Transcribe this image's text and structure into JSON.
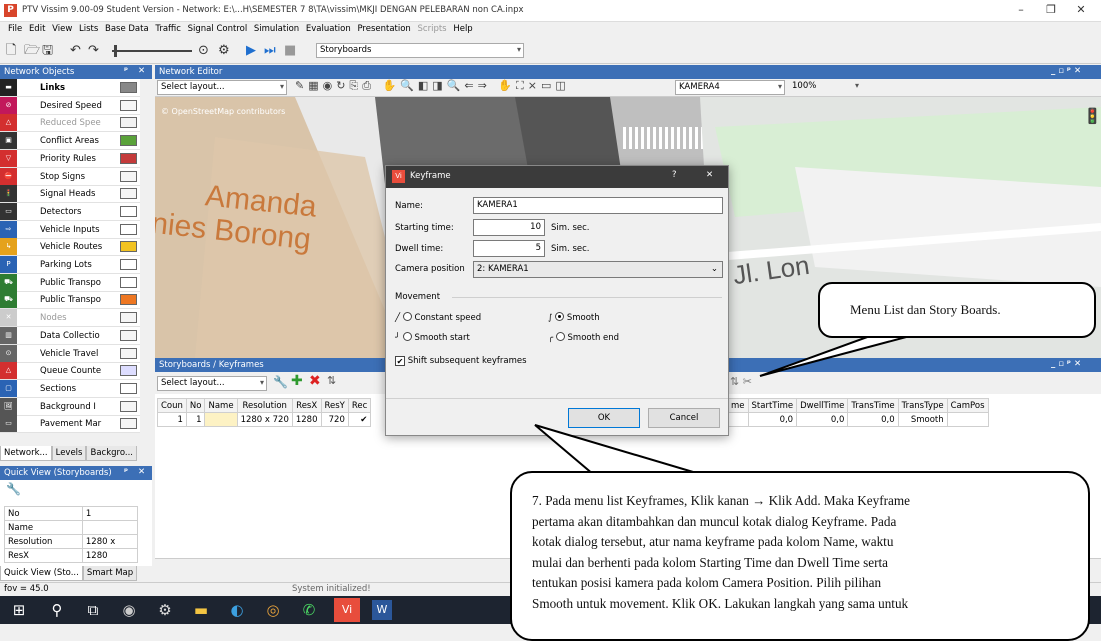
{
  "window": {
    "title": "PTV Vissim 9.00-09 Student Version - Network: E:\\...H\\SEMESTER 7 8\\TA\\vissim\\MKJI DENGAN PELEBARAN non CA.inpx",
    "app_icon": "ptv-logo",
    "controls": [
      "–",
      "❐",
      "✕"
    ]
  },
  "menu": [
    "File",
    "Edit",
    "View",
    "Lists",
    "Base Data",
    "Traffic",
    "Signal Control",
    "Simulation",
    "Evaluation",
    "Presentation",
    "Scripts",
    "Help"
  ],
  "toolbar": {
    "layout_combo": "Storyboards"
  },
  "network_objects": {
    "title": "Network Objects",
    "pin": "⌂",
    "close": "✕",
    "items": [
      {
        "label": "Links",
        "bold": true,
        "swatch": "#888888"
      },
      {
        "label": "Desired Speed",
        "swatch": "#f6f6f6"
      },
      {
        "label": "Reduced Spee",
        "swatch": "#f2f2f2",
        "dim": true
      },
      {
        "label": "Conflict Areas",
        "swatch": "#5aa23a"
      },
      {
        "label": "Priority Rules",
        "swatch": "#c43b3b"
      },
      {
        "label": "Stop Signs",
        "swatch": "#f5f5f5"
      },
      {
        "label": "Signal Heads",
        "swatch": "#f5f5f5"
      },
      {
        "label": "Detectors",
        "swatch": "#ffffff"
      },
      {
        "label": "Vehicle Inputs",
        "swatch": "#ffffff"
      },
      {
        "label": "Vehicle Routes",
        "swatch": "#f2c322"
      },
      {
        "label": "Parking Lots",
        "swatch": "#ffffff"
      },
      {
        "label": "Public Transpo",
        "swatch": "#ffffff"
      },
      {
        "label": "Public Transpo",
        "swatch": "#ee7722"
      },
      {
        "label": "Nodes",
        "swatch": "#f5f5f5",
        "dim": true
      },
      {
        "label": "Data Collectio",
        "swatch": "#f5f5f5"
      },
      {
        "label": "Vehicle Travel",
        "swatch": "#f5f5f5"
      },
      {
        "label": "Queue Counte",
        "swatch": "#ddddff"
      },
      {
        "label": "Sections",
        "swatch": "#ffffff"
      },
      {
        "label": "Background I",
        "swatch": "#f5f5f5"
      },
      {
        "label": "Pavement Mar",
        "swatch": "#f5f5f5"
      }
    ],
    "tabs": [
      "Network...",
      "Levels",
      "Backgro..."
    ]
  },
  "quick_view": {
    "title": "Quick View (Storyboards)",
    "rows": [
      {
        "name": "No",
        "value": "1"
      },
      {
        "name": "Name",
        "value": ""
      },
      {
        "name": "Resolution",
        "value": "1280 x"
      },
      {
        "name": "ResX",
        "value": "1280"
      }
    ],
    "tabs": [
      "Quick View (Sto...",
      "Smart Map"
    ]
  },
  "network_editor": {
    "title": "Network Editor",
    "layout_combo": "Select layout...",
    "camera_combo": "KAMERA4",
    "zoom": "100%",
    "map_attribution": "© OpenStreetMap contributors",
    "map_labels": [
      "Amanda",
      "nies Borong",
      "Jl. Lon"
    ]
  },
  "keyframe_dialog": {
    "title": "Keyframe",
    "help": "?",
    "close": "✕",
    "name_label": "Name:",
    "name_value": "KAMERA1",
    "start_label": "Starting time:",
    "start_value": "10",
    "start_unit": "Sim. sec.",
    "dwell_label": "Dwell time:",
    "dwell_value": "5",
    "dwell_unit": "Sim. sec.",
    "camera_label": "Camera position",
    "camera_value": "2: KAMERA1",
    "movement_label": "Movement",
    "options": [
      {
        "label": "Constant speed",
        "selected": false
      },
      {
        "label": "Smooth",
        "selected": true
      },
      {
        "label": "Smooth start",
        "selected": false
      },
      {
        "label": "Smooth end",
        "selected": false
      }
    ],
    "shift_label": "Shift subsequent keyframes",
    "shift_checked": true,
    "ok": "OK",
    "cancel": "Cancel"
  },
  "storyboards": {
    "title": "Storyboards / Keyframes",
    "layout_combo": "Select layout...",
    "left_columns": [
      "Coun",
      "No",
      "Name",
      "Resolution",
      "ResX",
      "ResY",
      "Rec"
    ],
    "left_row": [
      "1",
      "1",
      "",
      "1280 x 720",
      "1280",
      "720",
      "✔"
    ],
    "right_columns": [
      "me",
      "StartTime",
      "DwellTime",
      "TransTime",
      "TransType",
      "CamPos"
    ],
    "right_row": [
      "",
      "0,0",
      "0,0",
      "0,0",
      "Smooth",
      ""
    ]
  },
  "status": {
    "left": "fov = 45.0",
    "center": "System initialized!"
  },
  "callout_top": "Menu List dan Story Boards.",
  "callout_bottom": {
    "line1": "7. Pada menu list Keyframes, Klik kanan → Klik Add. Maka Keyframe",
    "line2": "pertama akan ditambahkan dan muncul kotak dialog Keyframe. Pada",
    "line3": "kotak dialog tersebut, atur nama keyframe pada kolom Name, waktu",
    "line4": "mulai dan berhenti pada kolom Starting Time dan Dwell Time serta",
    "line5": "tentukan posisi kamera pada kolom Camera Position. Pilih pilihan",
    "line6": "Smooth untuk movement. Klik OK. Lakukan langkah yang sama untuk"
  },
  "taskbar": [
    "windows-start-icon",
    "search-icon",
    "task-view-icon",
    "browser-icon",
    "settings-icon",
    "file-explorer-icon",
    "edge-icon",
    "chrome-icon",
    "whatsapp-icon",
    "vissim-icon",
    "word-icon"
  ],
  "colors": {
    "panel_header": "#3c6fb6",
    "dialog_title": "#3b3b3b",
    "taskbar": "#1d2430"
  }
}
